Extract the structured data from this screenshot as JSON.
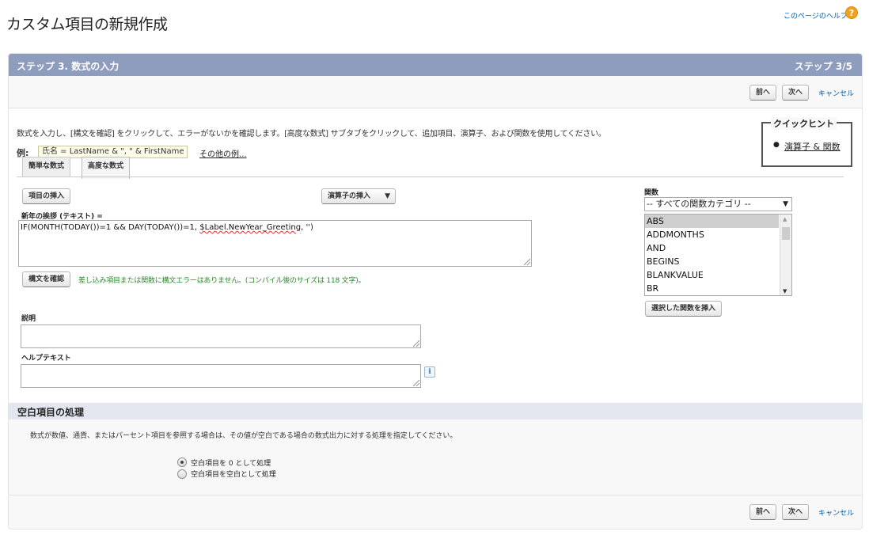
{
  "header": {
    "title": "カスタム項目の新規作成",
    "help_link": "このページのヘルプ",
    "help_icon": "?"
  },
  "step": {
    "title": "ステップ 3. 数式の入力",
    "count": "ステップ 3/5"
  },
  "nav": {
    "prev": "前へ",
    "next": "次へ",
    "cancel": "キャンセル"
  },
  "intro_text": "数式を入力し、[構文を確認] をクリックして、エラーがないかを確認します。[高度な数式] サブタブをクリックして、追加項目、演算子、および関数を使用してください。",
  "quick_hint": {
    "title": "クイックヒント",
    "link": "演算子 & 関数"
  },
  "example": {
    "label": "例:",
    "formula": "氏名 = LastName & \", \" & FirstName",
    "more": "その他の例..."
  },
  "tabs": [
    {
      "label": "簡単な数式"
    },
    {
      "label": "高度な数式"
    }
  ],
  "editor": {
    "insert_field": "項目の挿入",
    "insert_operator": "演算子の挿入",
    "field_label": "新年の挨拶 (テキスト) =",
    "formula_prefix": "IF(MONTH(TODAY())=1 && DAY(TODAY())=1,  ",
    "formula_merge": "$Label.NewYear_Greeting",
    "formula_suffix": ", '')",
    "check_syntax": "構文を確認",
    "check_result": "差し込み項目または関数に構文エラーはありません。(コンパイル後のサイズは 118 文字)。"
  },
  "functions": {
    "label": "関数",
    "category": "-- すべての関数カテゴリ --",
    "items": [
      "ABS",
      "ADDMONTHS",
      "AND",
      "BEGINS",
      "BLANKVALUE",
      "BR"
    ],
    "selected": "ABS",
    "insert_button": "選択した関数を挿入"
  },
  "description": {
    "label": "説明",
    "value": ""
  },
  "help_text": {
    "label": "ヘルプテキスト",
    "value": "",
    "info_icon": "i"
  },
  "blank_handling": {
    "title": "空白項目の処理",
    "description": "数式が数値、通貨、またはパーセント項目を参照する場合は、その値が空白である場合の数式出力に対する処理を指定してください。",
    "options": [
      {
        "label": "空白項目を 0 として処理",
        "selected": true
      },
      {
        "label": "空白項目を空白として処理",
        "selected": false
      }
    ]
  }
}
